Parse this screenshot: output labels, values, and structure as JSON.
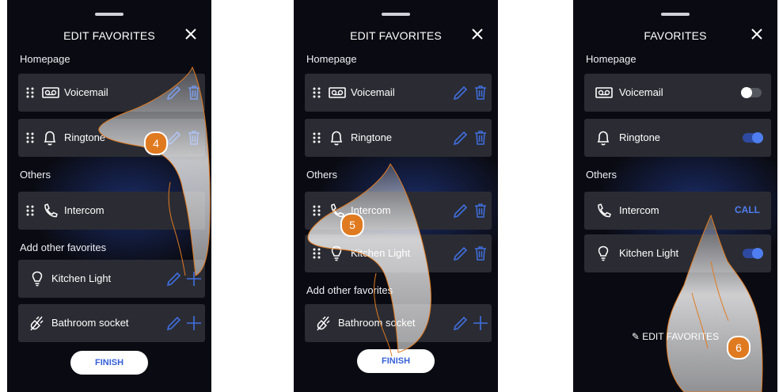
{
  "screens": [
    {
      "title": "EDIT FAVORITES",
      "homepage_label": "Homepage",
      "others_label": "Others",
      "add_label": "Add other favorites",
      "rows": [
        {
          "label": "Voicemail"
        },
        {
          "label": "Ringtone"
        },
        {
          "label": "Intercom"
        },
        {
          "label": "Kitchen Light"
        },
        {
          "label": "Bathroom socket"
        }
      ],
      "finish_label": "FINISH",
      "step": "4"
    },
    {
      "title": "EDIT FAVORITES",
      "homepage_label": "Homepage",
      "others_label": "Others",
      "add_label": "Add other favorites",
      "rows": [
        {
          "label": "Voicemail"
        },
        {
          "label": "Ringtone"
        },
        {
          "label": "Intercom"
        },
        {
          "label": "Kitchen Light"
        },
        {
          "label": "Bathroom socket"
        }
      ],
      "finish_label": "FINISH",
      "step": "5"
    },
    {
      "title": "FAVORITES",
      "homepage_label": "Homepage",
      "others_label": "Others",
      "rows": [
        {
          "label": "Voicemail",
          "toggle": "off"
        },
        {
          "label": "Ringtone",
          "toggle": "on"
        },
        {
          "label": "Intercom",
          "action": "CALL"
        },
        {
          "label": "Kitchen Light",
          "toggle": "on"
        }
      ],
      "edit_label": "EDIT FAVORITES",
      "step": "6"
    }
  ],
  "colors": {
    "accent": "#3f6fe0",
    "background": "#0a0b12",
    "row": "#2b2c33",
    "step_badge": "#e07a20"
  }
}
